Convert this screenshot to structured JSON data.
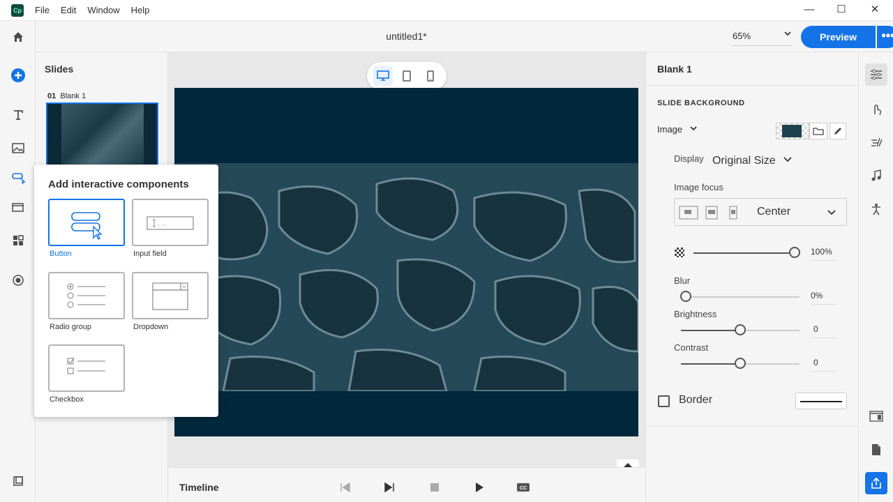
{
  "app": {
    "logo": "Cp"
  },
  "menu": [
    "File",
    "Edit",
    "Window",
    "Help"
  ],
  "window_controls": {
    "minimize": "—",
    "maximize": "☐",
    "close": "✕"
  },
  "topbar": {
    "doc_title": "untitled1*",
    "zoom": "65%",
    "preview": "Preview",
    "more": "•••"
  },
  "slides": {
    "panel_title": "Slides",
    "items": [
      {
        "number": "01",
        "label": "Blank 1"
      }
    ]
  },
  "popover": {
    "title": "Add interactive components",
    "items": [
      {
        "label": "Button",
        "selected": true
      },
      {
        "label": "Input field",
        "selected": false
      },
      {
        "label": "Radio group",
        "selected": false
      },
      {
        "label": "Dropdown",
        "selected": false
      },
      {
        "label": "Checkbox",
        "selected": false
      }
    ]
  },
  "timeline": {
    "title": "Timeline"
  },
  "properties": {
    "title": "Blank 1",
    "section": "SLIDE BACKGROUND",
    "bg_type": "Image",
    "display_label": "Display",
    "display_value": "Original Size",
    "focus_label": "Image focus",
    "focus_value": "Center",
    "opacity": {
      "value": "100%",
      "level": 1.0
    },
    "blur": {
      "label": "Blur",
      "value": "0%",
      "level": 0.0
    },
    "brightness": {
      "label": "Brightness",
      "value": "0",
      "level": 0.5
    },
    "contrast": {
      "label": "Contrast",
      "value": "0",
      "level": 0.5
    },
    "border_label": "Border"
  },
  "colors": {
    "accent": "#1473e6",
    "stage": "#01283d"
  }
}
